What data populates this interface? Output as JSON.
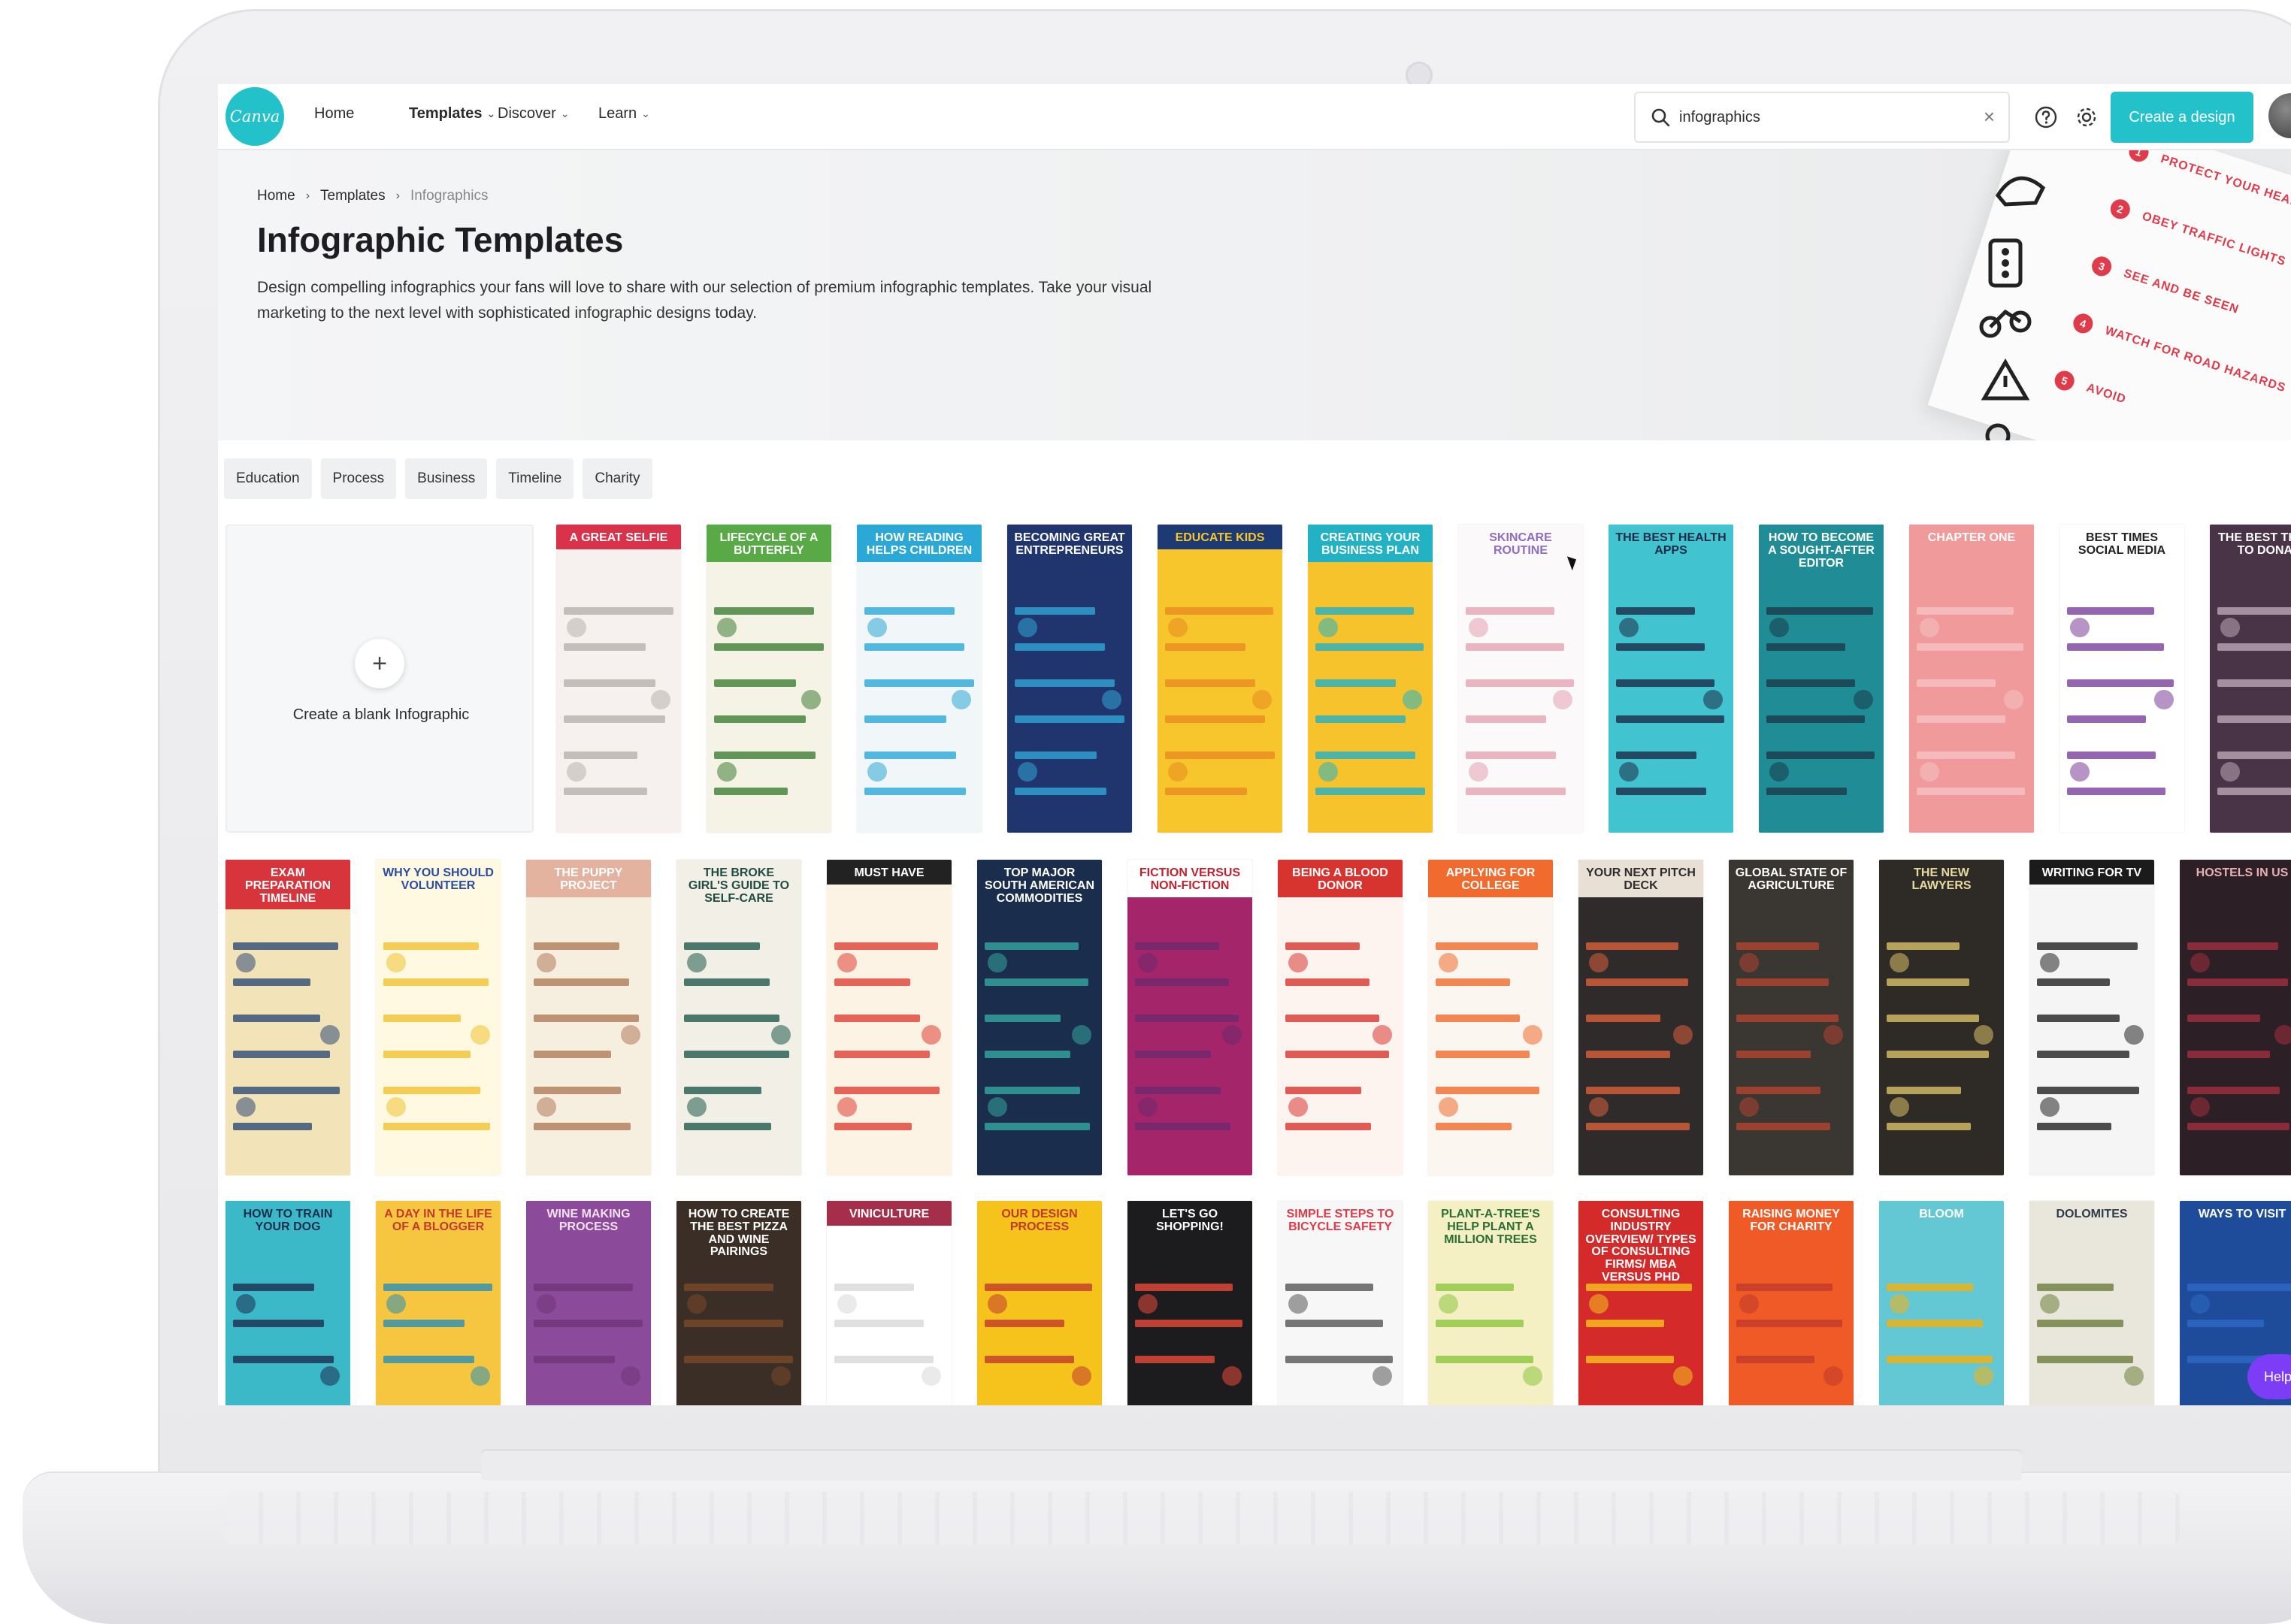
{
  "nav": {
    "logo_text": "Canva",
    "items": [
      {
        "label": "Home",
        "bold": false,
        "dropdown": false
      },
      {
        "label": "Templates",
        "bold": true,
        "dropdown": true
      },
      {
        "label": "Discover",
        "bold": false,
        "dropdown": true
      },
      {
        "label": "Learn",
        "bold": false,
        "dropdown": true
      }
    ],
    "search_value": "infographics",
    "create_button": "Create a design",
    "icons": [
      "search-icon",
      "clear-icon",
      "help-icon",
      "settings-icon"
    ]
  },
  "hero": {
    "breadcrumb": [
      "Home",
      "Templates",
      "Infographics"
    ],
    "title": "Infographic Templates",
    "description": "Design compelling infographics your fans will love to share with our selection of premium infographic templates. Take your visual marketing to the next level with sophisticated infographic designs today.",
    "steps": [
      {
        "num": "1",
        "label": "PROTECT YOUR HEAD"
      },
      {
        "num": "2",
        "label": "OBEY TRAFFIC LIGHTS"
      },
      {
        "num": "3",
        "label": "SEE AND BE SEEN"
      },
      {
        "num": "4",
        "label": "WATCH FOR ROAD HAZARDS"
      },
      {
        "num": "5",
        "label": "AVOID"
      }
    ]
  },
  "filters": [
    "Education",
    "Process",
    "Business",
    "Timeline",
    "Charity"
  ],
  "blank_card": {
    "label": "Create a blank Infographic",
    "plus": "+"
  },
  "templates": [
    {
      "title": "A Great Selfie",
      "bg": "#f6f1ee",
      "head": "#d9324a",
      "fg": "#ffffff",
      "accent": "#b8b2ad"
    },
    {
      "title": "Lifecycle of a Butterfly",
      "bg": "#f5f2e6",
      "head": "#5aa947",
      "fg": "#ffffff",
      "accent": "#3d7d34"
    },
    {
      "title": "How Reading Helps Children",
      "bg": "#f1f7f9",
      "head": "#2ba8d6",
      "fg": "#ffffff",
      "accent": "#2ba8d6"
    },
    {
      "title": "Becoming Great Entrepreneurs",
      "bg": "#20346e",
      "head": "#20346e",
      "fg": "#ffffff",
      "accent": "#31a6d4"
    },
    {
      "title": "Educate Kids",
      "bg": "#f7c52c",
      "head": "#1d3a74",
      "fg": "#f7c52c",
      "accent": "#e88a23"
    },
    {
      "title": "Creating Your Business Plan",
      "bg": "#f7c32d",
      "head": "#22b2c4",
      "fg": "#ffffff",
      "accent": "#22b2c4"
    },
    {
      "title": "Skincare Routine",
      "bg": "#fbf9f9",
      "head": "#fbf9f9",
      "fg": "#8f6cc1",
      "accent": "#e6a3b3"
    },
    {
      "title": "The Best Health Apps",
      "bg": "#41c4cf",
      "head": "#41c4cf",
      "fg": "#1d2b46",
      "accent": "#1d2b46"
    },
    {
      "title": "How to Become a Sought-After Editor",
      "bg": "#1f8c96",
      "head": "#1f8c96",
      "fg": "#ffffff",
      "accent": "#1a3a4a"
    },
    {
      "title": "Chapter One",
      "bg": "#f09a9c",
      "head": "#f09a9c",
      "fg": "#ffffff",
      "accent": "#f6c2c3"
    },
    {
      "title": "Best Times Social Media",
      "bg": "#ffffff",
      "head": "#ffffff",
      "fg": "#222222",
      "accent": "#7a3e98"
    },
    {
      "title": "The Best Things To Donate",
      "bg": "#493447",
      "head": "#493447",
      "fg": "#ffffff",
      "accent": "#b9a7b5"
    },
    {
      "title": "Exam Preparation Timeline",
      "bg": "#f2e3b8",
      "head": "#d8343b",
      "fg": "#ffffff",
      "accent": "#2d4b74"
    },
    {
      "title": "Why You Should Volunteer",
      "bg": "#fff9e2",
      "head": "#fff9e2",
      "fg": "#2b4d9d",
      "accent": "#f1c232"
    },
    {
      "title": "The Puppy Project",
      "bg": "#f6efdf",
      "head": "#e3b3a0",
      "fg": "#ffffff",
      "accent": "#b07a5a"
    },
    {
      "title": "The Broke Girl's Guide to Self-Care",
      "bg": "#f2efe7",
      "head": "#f2efe7",
      "fg": "#1f4c43",
      "accent": "#1f5a4d"
    },
    {
      "title": "Must Have",
      "bg": "#fcf3e4",
      "head": "#222222",
      "fg": "#ffffff",
      "accent": "#e03e34"
    },
    {
      "title": "Top Major South American Commodities",
      "bg": "#1b2d4c",
      "head": "#1b2d4c",
      "fg": "#ffffff",
      "accent": "#35a6a1"
    },
    {
      "title": "Fiction versus Non-Fiction",
      "bg": "#a5256b",
      "head": "#ffffff",
      "fg": "#c1222e",
      "accent": "#6d2a6e"
    },
    {
      "title": "Being a Blood Donor",
      "bg": "#fdf3ef",
      "head": "#d8342f",
      "fg": "#ffffff",
      "accent": "#d8342f"
    },
    {
      "title": "Applying for College",
      "bg": "#fbf6ef",
      "head": "#f06b2d",
      "fg": "#ffffff",
      "accent": "#f06b2d"
    },
    {
      "title": "Your Next Pitch Deck",
      "bg": "#2f2b2a",
      "head": "#e9e0d5",
      "fg": "#2f2b2a",
      "accent": "#d9613a"
    },
    {
      "title": "Global State of Agriculture",
      "bg": "#3a3733",
      "head": "#3a3733",
      "fg": "#ffffff",
      "accent": "#b3442e"
    },
    {
      "title": "The New Lawyers",
      "bg": "#2e2b26",
      "head": "#2e2b26",
      "fg": "#e8d9a0",
      "accent": "#d9c06a"
    },
    {
      "title": "Writing for TV",
      "bg": "#f5f5f5",
      "head": "#1b1b1b",
      "fg": "#ffffff",
      "accent": "#222222"
    },
    {
      "title": "Hostels in US",
      "bg": "#2c1f25",
      "head": "#2c1f25",
      "fg": "#e7b0b6",
      "accent": "#a03040"
    },
    {
      "title": "How to Train Your Dog",
      "bg": "#3cb9c9",
      "head": "#3cb9c9",
      "fg": "#1b2d4c",
      "accent": "#1b2d4c"
    },
    {
      "title": "A Day in the Life of a Blogger",
      "bg": "#f6c640",
      "head": "#f6c640",
      "fg": "#c43a2c",
      "accent": "#2a8fb7"
    },
    {
      "title": "Wine Making Process",
      "bg": "#8c4a9a",
      "head": "#8c4a9a",
      "fg": "#f4e1f2",
      "accent": "#6f3479"
    },
    {
      "title": "How to Create the Best Pizza and Wine Pairings",
      "bg": "#3b2e27",
      "head": "#3b2e27",
      "fg": "#ffffff",
      "accent": "#7c4a2a"
    },
    {
      "title": "Viniculture",
      "bg": "#ffffff",
      "head": "#a52e4a",
      "fg": "#ffffff",
      "accent": "#d8d8d8"
    },
    {
      "title": "Our Design Process",
      "bg": "#f6c31d",
      "head": "#f6c31d",
      "fg": "#c0392b",
      "accent": "#c0392b"
    },
    {
      "title": "Let's Go Shopping!",
      "bg": "#1c1c1e",
      "head": "#1c1c1e",
      "fg": "#ffffff",
      "accent": "#e84b3c"
    },
    {
      "title": "Simple Steps to Bicycle Safety",
      "bg": "#f7f7f7",
      "head": "#f7f7f7",
      "fg": "#e03b4a",
      "accent": "#555555"
    },
    {
      "title": "Plant-a-Tree's Help Plant a Million Trees",
      "bg": "#f4f0c4",
      "head": "#f4f0c4",
      "fg": "#2c6d35",
      "accent": "#8cc63f"
    },
    {
      "title": "Consulting industry overview/ Types of consulting firms/ MBA versus PhD",
      "bg": "#d42a2a",
      "head": "#d42a2a",
      "fg": "#ffffff",
      "accent": "#f6c31d"
    },
    {
      "title": "Raising Money for Charity",
      "bg": "#ef5a27",
      "head": "#ef5a27",
      "fg": "#ffffff",
      "accent": "#c0392b"
    },
    {
      "title": "Bloom",
      "bg": "#64c7d4",
      "head": "#64c7d4",
      "fg": "#ffffff",
      "accent": "#f5b20c"
    },
    {
      "title": "Dolomites",
      "bg": "#e9e6dc",
      "head": "#e9e6dc",
      "fg": "#2f3a4a",
      "accent": "#6d7d3b"
    },
    {
      "title": "Ways to Visit",
      "bg": "#1e4c9a",
      "head": "#1e4c9a",
      "fg": "#ffffff",
      "accent": "#2d69c4"
    }
  ],
  "help_label": "Help"
}
